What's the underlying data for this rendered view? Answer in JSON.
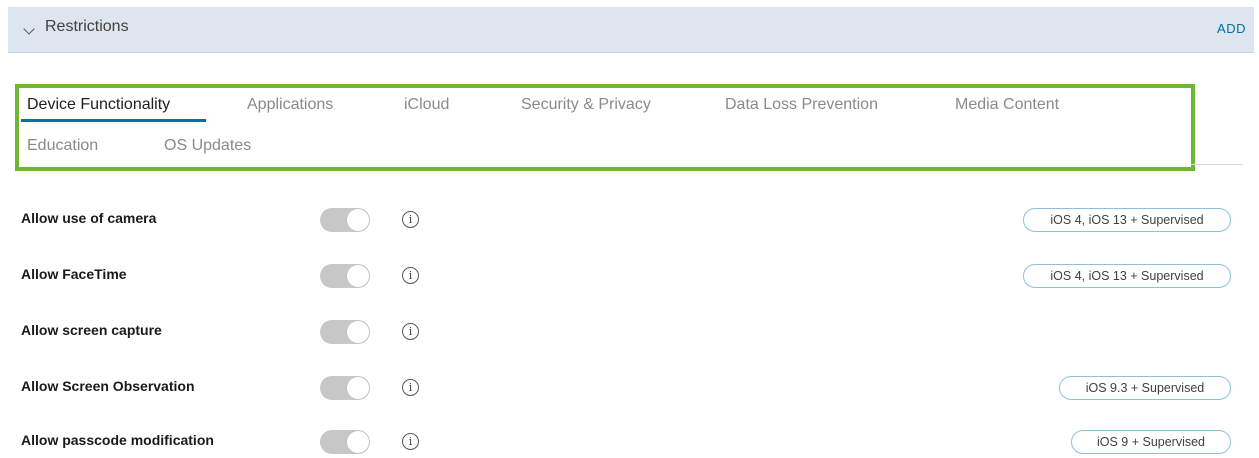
{
  "section": {
    "title": "Restrictions",
    "add_label": "ADD"
  },
  "colors": {
    "accent": "#0072a3",
    "highlight": "#6fb536",
    "header_bg": "#dde6ee",
    "toggle_off": "#c7c7c7"
  },
  "icons": {
    "collapse": "chevron-down-icon",
    "info": "info-icon"
  },
  "tabs": [
    {
      "label": "Device Functionality",
      "active": true
    },
    {
      "label": "Applications",
      "active": false
    },
    {
      "label": "iCloud",
      "active": false
    },
    {
      "label": "Security & Privacy",
      "active": false
    },
    {
      "label": "Data Loss Prevention",
      "active": false
    },
    {
      "label": "Media Content",
      "active": false
    },
    {
      "label": "Education",
      "active": false
    },
    {
      "label": "OS Updates",
      "active": false
    }
  ],
  "rows": [
    {
      "label": "Allow use of camera",
      "enabled": true,
      "badge": "iOS 4, iOS 13 + Supervised"
    },
    {
      "label": "Allow FaceTime",
      "enabled": true,
      "badge": "iOS 4, iOS 13 + Supervised"
    },
    {
      "label": "Allow screen capture",
      "enabled": true,
      "badge": ""
    },
    {
      "label": "Allow Screen Observation",
      "enabled": true,
      "badge": "iOS 9.3 + Supervised"
    },
    {
      "label": "Allow passcode modification",
      "enabled": true,
      "badge": "iOS 9 + Supervised"
    }
  ]
}
